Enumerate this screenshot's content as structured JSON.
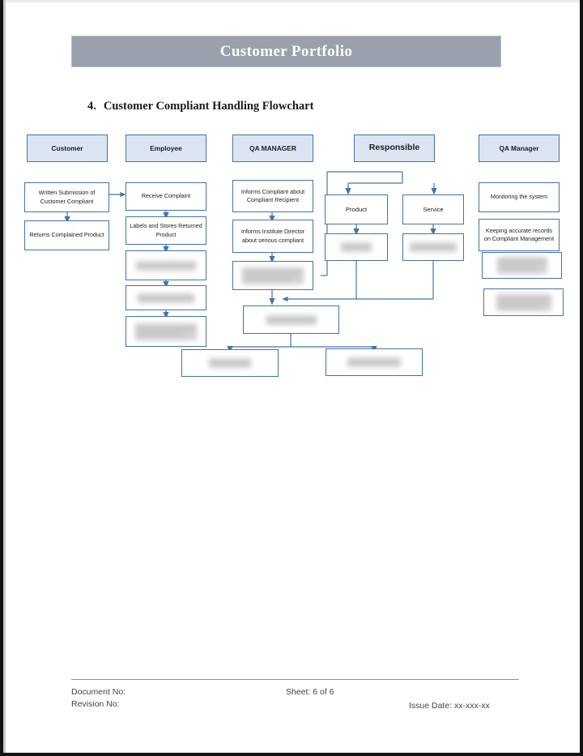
{
  "banner": {
    "title": "Customer Portfolio"
  },
  "section": {
    "number": "4.",
    "title": "Customer Compliant Handling Flowchart"
  },
  "flowchart": {
    "columns": [
      {
        "id": "customer",
        "label": "Customer"
      },
      {
        "id": "employee",
        "label": "Employee"
      },
      {
        "id": "qa-manager",
        "label": "QA MANAGER"
      },
      {
        "id": "responsible",
        "label": "Responsible"
      },
      {
        "id": "qa-manager-2",
        "label": "QA Manager"
      }
    ],
    "nodes": {
      "customer": [
        {
          "id": "c1",
          "label": "Written Submission of Customer Compliant",
          "redacted": false
        },
        {
          "id": "c2",
          "label": "Returns Complained Product",
          "redacted": false
        }
      ],
      "employee": [
        {
          "id": "e1",
          "label": "Receive Complaint",
          "redacted": false
        },
        {
          "id": "e2",
          "label": "Labels and Stores Returned Product",
          "redacted": false
        },
        {
          "id": "e3",
          "label": "",
          "redacted": true
        },
        {
          "id": "e4",
          "label": "",
          "redacted": true
        },
        {
          "id": "e5",
          "label": "",
          "redacted": true
        }
      ],
      "qa_manager": [
        {
          "id": "q1",
          "label": "Informs Compliant about Compliant Recipient",
          "redacted": false
        },
        {
          "id": "q2",
          "label": "Informs Institute Director about serious compliant",
          "redacted": false
        },
        {
          "id": "q3",
          "label": "",
          "redacted": true
        }
      ],
      "responsible": [
        {
          "id": "r1",
          "label": "Product",
          "redacted": false
        },
        {
          "id": "r2",
          "label": "Service",
          "redacted": false
        },
        {
          "id": "r3",
          "label": "",
          "redacted": true
        },
        {
          "id": "r4",
          "label": "",
          "redacted": true
        }
      ],
      "qa_manager_2": [
        {
          "id": "m1",
          "label": "Monitoring the system",
          "redacted": false
        },
        {
          "id": "m2",
          "label": "Keeping accurate records on Compliant Management",
          "redacted": false
        },
        {
          "id": "m3",
          "label": "",
          "redacted": true
        },
        {
          "id": "m4",
          "label": "",
          "redacted": true
        }
      ],
      "bottom": [
        {
          "id": "b1",
          "label": "",
          "redacted": true
        },
        {
          "id": "b2",
          "label": "",
          "redacted": true
        },
        {
          "id": "b3",
          "label": "",
          "redacted": true
        }
      ]
    }
  },
  "footer": {
    "document_no": "Document No:",
    "revision_no": "Revision No:",
    "sheet": "Sheet: 6 of 6",
    "issue_date": "Issue Date: xx-xxx-xx"
  },
  "colors": {
    "banner_fill": "#9aa1ac",
    "header_box_fill": "#dbe5f1",
    "box_border": "#4573a7",
    "connector": "#4573a7",
    "page_background": "#ffffff"
  }
}
